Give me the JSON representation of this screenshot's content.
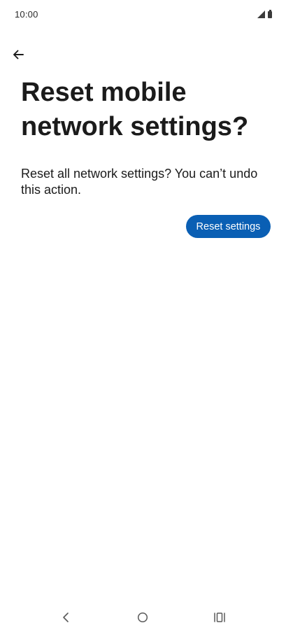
{
  "status_bar": {
    "time": "10:00",
    "icons": [
      "signal-icon",
      "battery-icon"
    ]
  },
  "header": {
    "back_icon": "arrow-back-icon"
  },
  "main": {
    "title": "Reset mobile network settings?",
    "description": "Reset all network settings? You can’t undo this action.",
    "reset_button_label": "Reset settings"
  },
  "nav_bar": {
    "icons": [
      "nav-back-icon",
      "nav-home-icon",
      "nav-recents-icon"
    ]
  },
  "colors": {
    "accent": "#0a5fb4",
    "text": "#1b1b1b",
    "background": "#ffffff"
  }
}
